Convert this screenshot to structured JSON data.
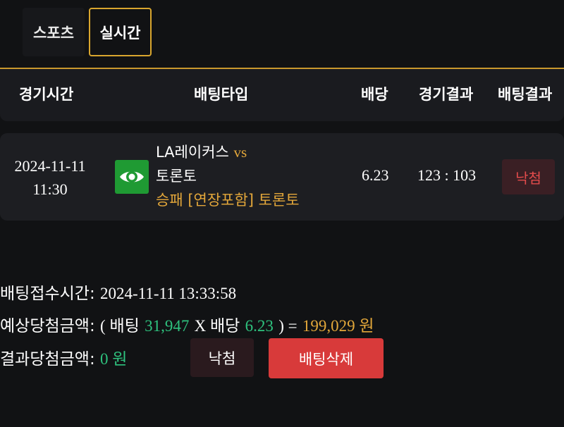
{
  "tabs": {
    "sports": "스포츠",
    "live": "실시간"
  },
  "table_header": {
    "game_time": "경기시간",
    "bet_type": "배팅타입",
    "odds": "배당",
    "game_result": "경기결과",
    "bet_result": "배팅결과"
  },
  "bet": {
    "date": "2024-11-11",
    "time": "11:30",
    "sport_icon": "eye-icon",
    "home_team": "LA레이커스",
    "vs": "vs",
    "away_team": "토론토",
    "bet_type": "승패 [연장포함] 토론토",
    "odds": "6.23",
    "score": "123 : 103",
    "result": "낙첨"
  },
  "summary": {
    "received_label": "배팅접수시간:",
    "received_value": "2024-11-11 13:33:58",
    "expected_label": "예상당첨금액:",
    "open_paren": "( 배팅",
    "stake": "31,947",
    "times": "X 배당",
    "odds": "6.23",
    "close_paren": ") =",
    "payout": "199,029 원",
    "result_label": "결과당첨금액:",
    "result_value": "0 원"
  },
  "buttons": {
    "lose": "낙첨",
    "delete": "배팅삭제"
  },
  "colors": {
    "accent": "#d9a62e",
    "green": "#2ec27e",
    "red": "#d83a3a"
  }
}
